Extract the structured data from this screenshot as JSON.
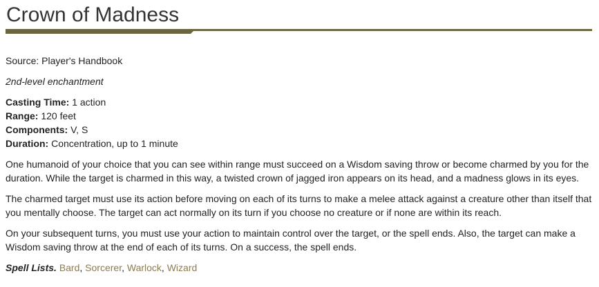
{
  "spell": {
    "name": "Crown of Madness",
    "source_label": "Source: Player's Handbook",
    "school": "2nd-level enchantment",
    "properties": [
      {
        "key": "Casting Time:",
        "value": " 1 action"
      },
      {
        "key": "Range:",
        "value": " 120 feet"
      },
      {
        "key": "Components:",
        "value": " V, S"
      },
      {
        "key": "Duration:",
        "value": " Concentration, up to 1 minute"
      }
    ],
    "paragraphs": [
      "One humanoid of your choice that you can see within range must succeed on a Wisdom saving throw or become charmed by you for the duration. While the target is charmed in this way, a twisted crown of jagged iron appears on its head, and a madness glows in its eyes.",
      "The charmed target must use its action before moving on each of its turns to make a melee attack against a creature other than itself that you mentally choose. The target can act normally on its turn if you choose no creature or if none are within its reach.",
      "On your subsequent turns, you must use your action to maintain control over the target, or the spell ends. Also, the target can make a Wisdom saving throw at the end of each of its turns. On a success, the spell ends."
    ],
    "spell_lists_label": "Spell Lists.",
    "spell_lists": [
      "Bard",
      "Sorcerer",
      "Warlock",
      "Wizard"
    ],
    "separator": ", "
  },
  "colors": {
    "accent": "#6b6540",
    "link": "#8a7b52",
    "text": "#222222"
  }
}
